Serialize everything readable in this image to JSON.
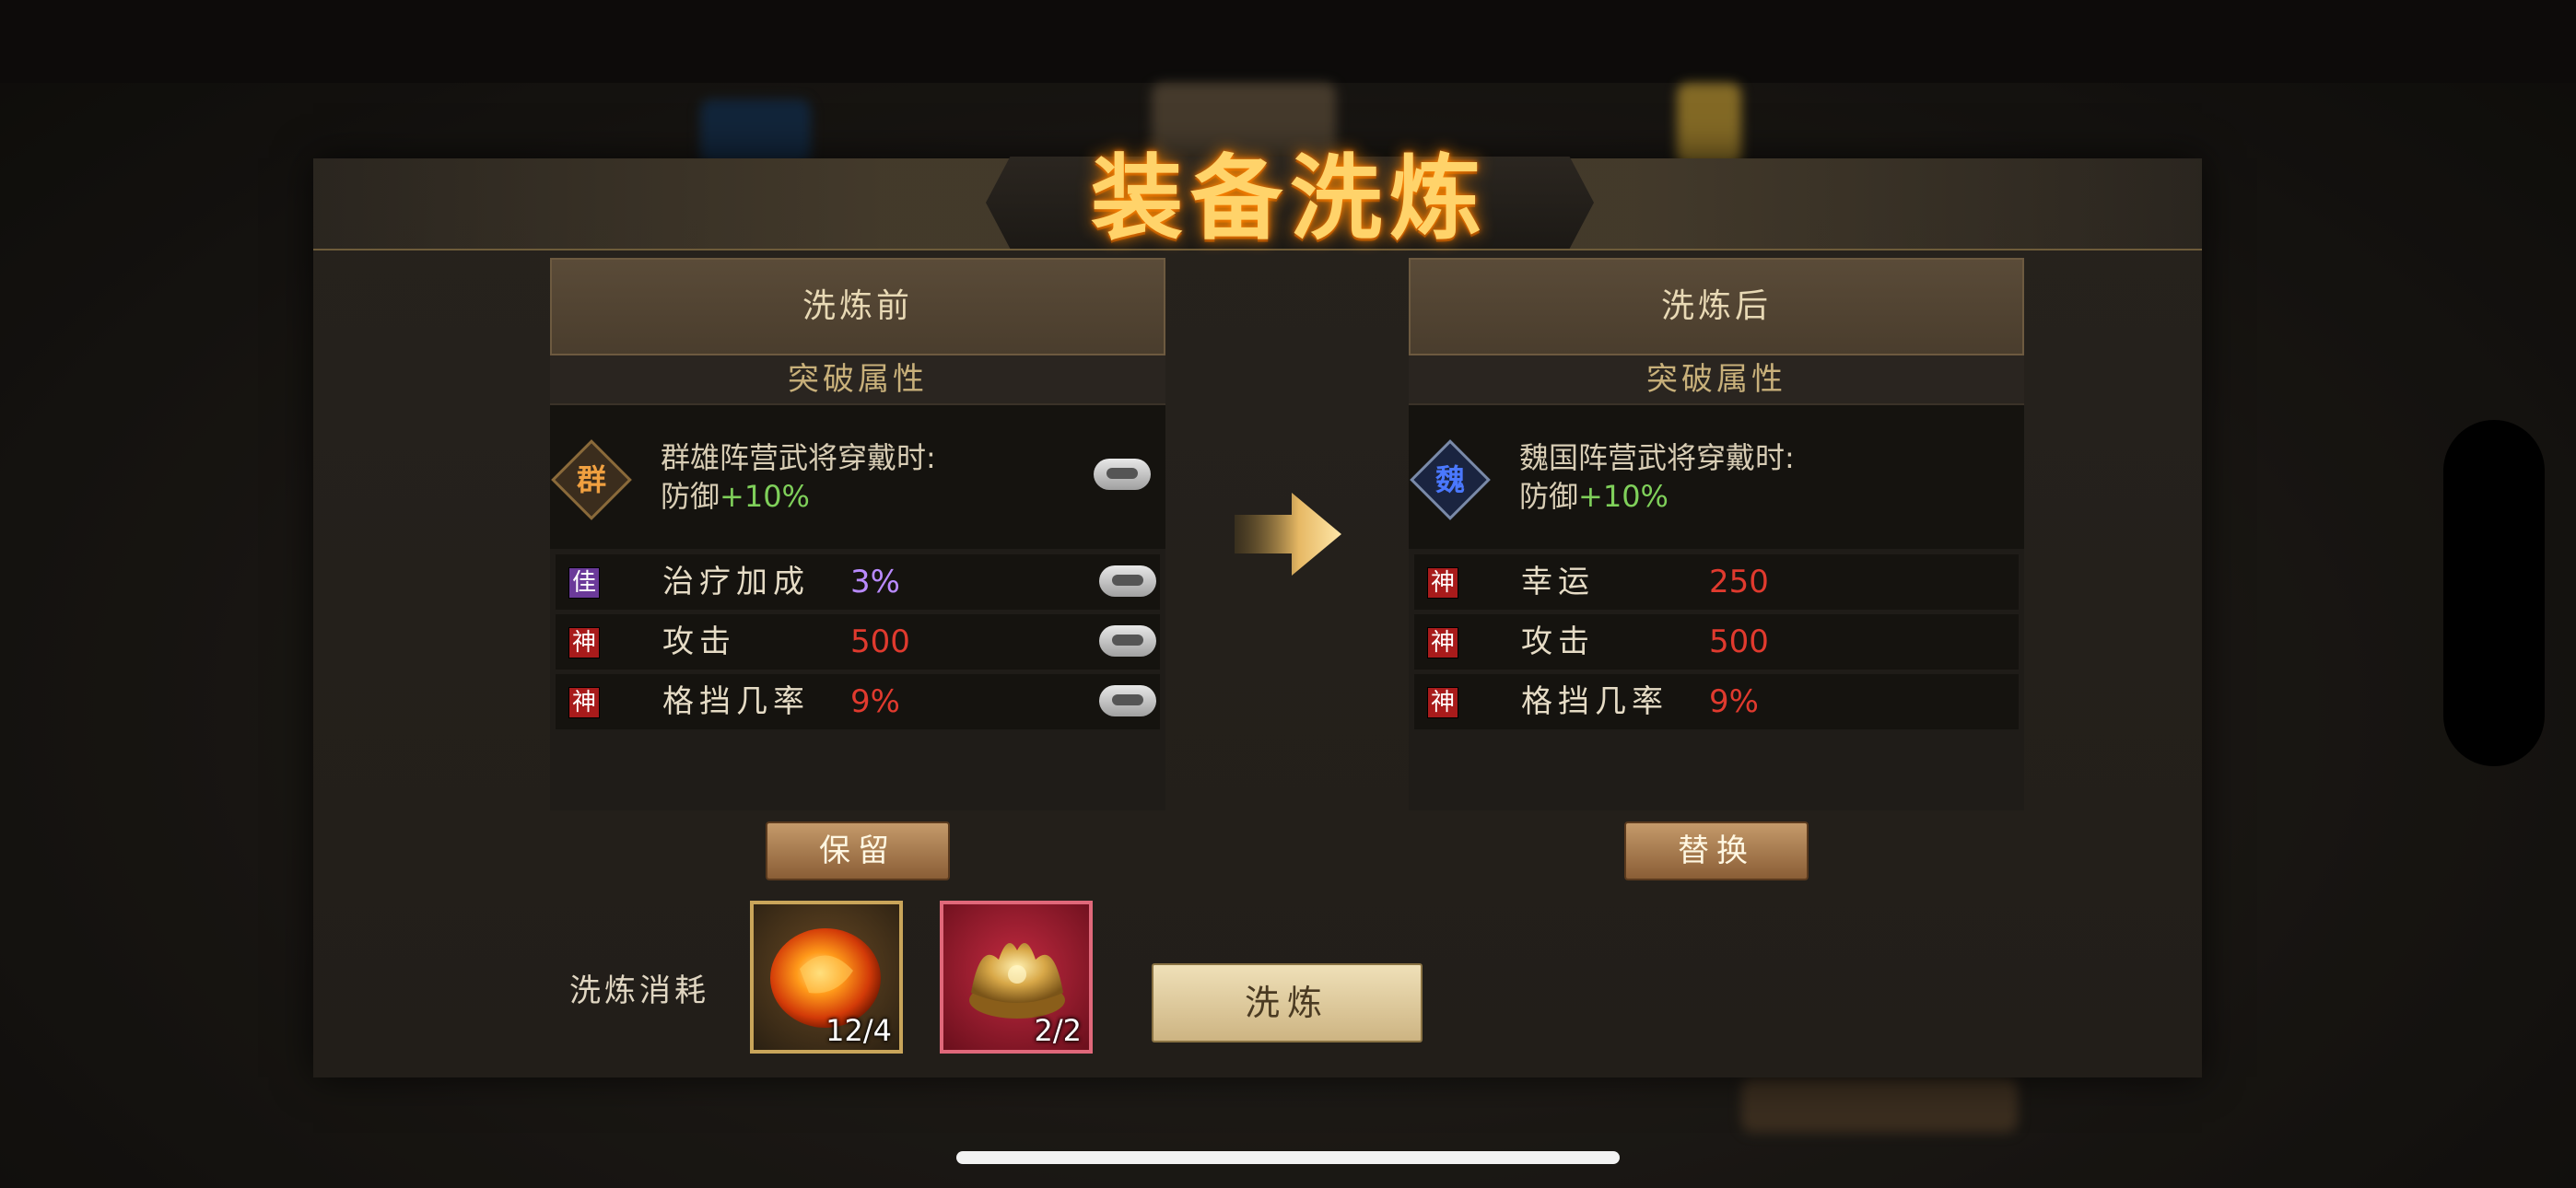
{
  "title": "装备洗炼",
  "colors": {
    "accent_gold": "#ffd36a",
    "value_red": "#e03a2e",
    "value_purple": "#b98aff",
    "value_green": "#7fd05a"
  },
  "before": {
    "header": "洗炼前",
    "section": "突破属性",
    "faction_badge": "群",
    "break_line1": "群雄阵营武将穿戴时:",
    "break_stat": "防御",
    "break_value": "+10%",
    "attributes": [
      {
        "tag": "佳",
        "tag_color": "purple",
        "name": "治疗加成",
        "value": "3%",
        "value_color": "#b98aff"
      },
      {
        "tag": "神",
        "tag_color": "red",
        "name": "攻击",
        "value": "500",
        "value_color": "#e03a2e"
      },
      {
        "tag": "神",
        "tag_color": "red",
        "name": "格挡几率",
        "value": "9%",
        "value_color": "#e03a2e"
      }
    ],
    "button": "保留"
  },
  "after": {
    "header": "洗炼后",
    "section": "突破属性",
    "faction_badge": "魏",
    "break_line1": "魏国阵营武将穿戴时:",
    "break_stat": "防御",
    "break_value": "+10%",
    "attributes": [
      {
        "tag": "神",
        "tag_color": "red",
        "name": "幸运",
        "value": "250",
        "value_color": "#e03a2e"
      },
      {
        "tag": "神",
        "tag_color": "red",
        "name": "攻击",
        "value": "500",
        "value_color": "#e03a2e"
      },
      {
        "tag": "神",
        "tag_color": "red",
        "name": "格挡几率",
        "value": "9%",
        "value_color": "#e03a2e"
      }
    ],
    "button": "替换"
  },
  "cost": {
    "label": "洗炼消耗",
    "items": [
      {
        "icon": "refine-stone-icon",
        "count": "12/4"
      },
      {
        "icon": "golden-crown-icon",
        "count": "2/2"
      }
    ]
  },
  "refine_button": "洗炼"
}
